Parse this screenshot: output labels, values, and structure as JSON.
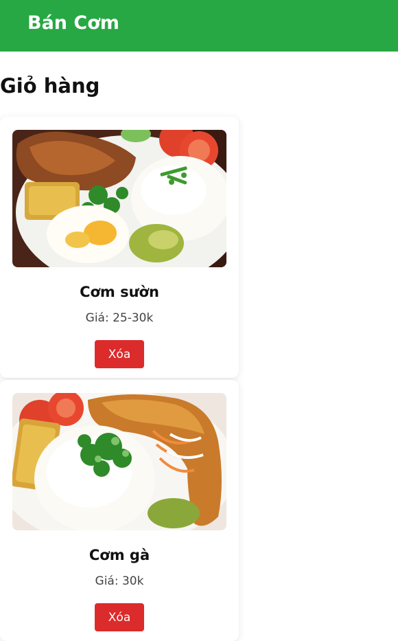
{
  "header": {
    "app_title": "Bán Cơm"
  },
  "page": {
    "title": "Giỏ hàng"
  },
  "cart": {
    "items": [
      {
        "name": "Cơm sườn",
        "price": "Giá: 25-30k",
        "delete_label": "Xóa"
      },
      {
        "name": "Cơm gà",
        "price": "Giá: 30k",
        "delete_label": "Xóa"
      }
    ]
  },
  "colors": {
    "header_bg": "#27a844",
    "delete_button": "#dc2b2b"
  }
}
